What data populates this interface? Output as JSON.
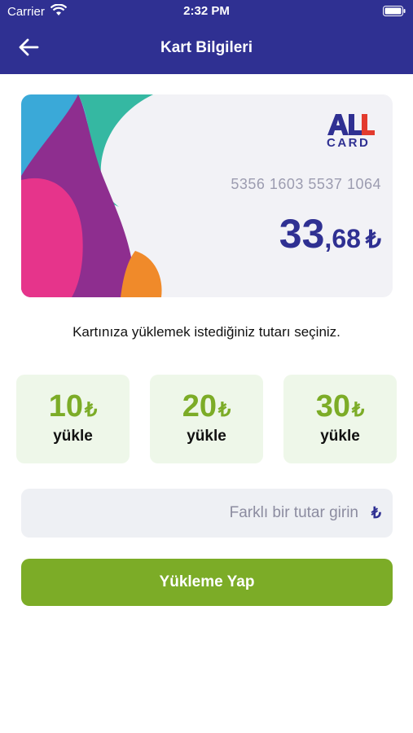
{
  "status_bar": {
    "carrier": "Carrier",
    "time": "2:32 PM"
  },
  "header": {
    "title": "Kart Bilgileri"
  },
  "card": {
    "number": "5356 1603 5537 1064",
    "balance_integer": "33",
    "balance_decimal": ",68",
    "currency": "₺",
    "logo_text": "CARD"
  },
  "prompt": "Kartınıza yüklemek istediğiniz tutarı seçiniz.",
  "amounts": [
    {
      "value": "10",
      "currency": "₺",
      "label": "yükle"
    },
    {
      "value": "20",
      "currency": "₺",
      "label": "yükle"
    },
    {
      "value": "30",
      "currency": "₺",
      "label": "yükle"
    }
  ],
  "custom_amount": {
    "placeholder": "Farklı bir tutar girin",
    "value": "",
    "currency": "₺"
  },
  "submit_label": "Yükleme Yap",
  "colors": {
    "header": "#2f3092",
    "accent": "#7cac27",
    "tile_bg": "#eef7e9",
    "input_bg": "#eef0f4"
  }
}
